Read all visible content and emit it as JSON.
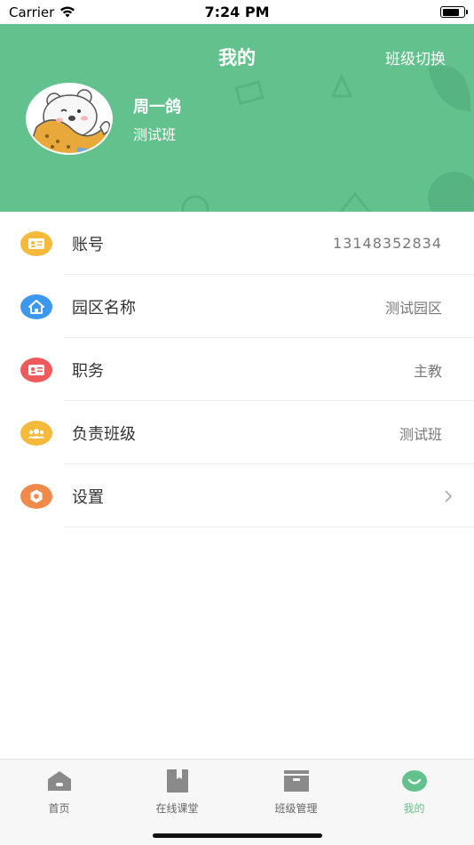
{
  "status_bar": {
    "carrier": "Carrier",
    "time": "7:24 PM"
  },
  "header": {
    "title": "我的",
    "switch_label": "班级切换",
    "user_name": "周一鸽",
    "user_class": "测试班",
    "background_color": "#62c18d"
  },
  "list": {
    "account": {
      "label": "账号",
      "value": "13148352834",
      "icon": "contact-card-icon",
      "color": "#f5b93b"
    },
    "park": {
      "label": "园区名称",
      "value": "测试园区",
      "icon": "home-icon",
      "color": "#3b97f0"
    },
    "position": {
      "label": "职务",
      "value": "主教",
      "icon": "id-card-icon",
      "color": "#ef5a5a"
    },
    "class": {
      "label": "负责班级",
      "value": "测试班",
      "icon": "group-icon",
      "color": "#f5b93b"
    },
    "settings": {
      "label": "设置",
      "icon": "gear-icon",
      "color": "#f08a4b"
    }
  },
  "tabs": [
    {
      "label": "首页",
      "icon": "home-tab-icon"
    },
    {
      "label": "在线课堂",
      "icon": "book-icon"
    },
    {
      "label": "班级管理",
      "icon": "box-icon"
    },
    {
      "label": "我的",
      "icon": "smile-icon",
      "active": true
    }
  ],
  "colors": {
    "accent": "#62c18d",
    "tab_inactive": "#8a8a8a"
  }
}
